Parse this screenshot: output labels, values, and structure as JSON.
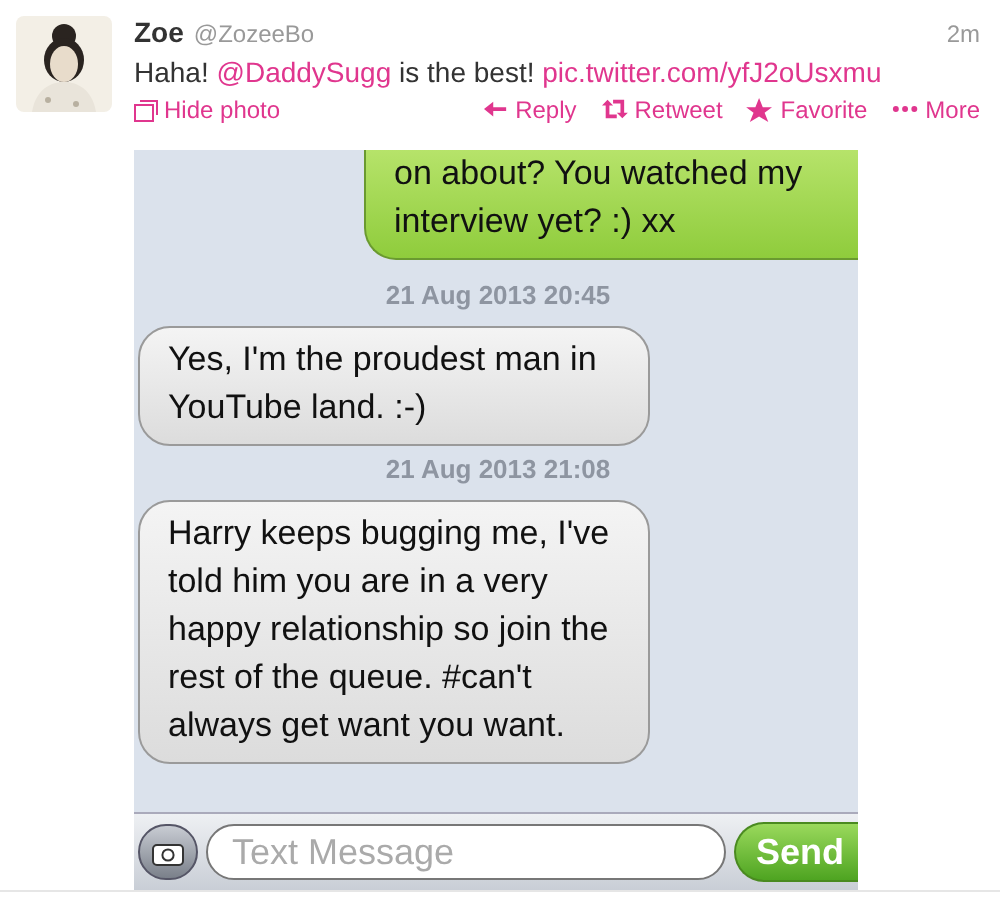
{
  "tweet": {
    "name": "Zoe",
    "handle": "@ZozeeBo",
    "time": "2m",
    "text": "Haha! ",
    "mention": "@DaddySugg",
    "text_after": " is the best! ",
    "link": "pic.twitter.com/yfJ2oUsxmu",
    "hide_photo": "Hide photo",
    "actions": [
      {
        "kind": "reply",
        "label": "Reply"
      },
      {
        "kind": "retweet",
        "label": "Retweet"
      },
      {
        "kind": "favorite",
        "label": "Favorite"
      },
      {
        "kind": "more",
        "label": "More"
      }
    ]
  },
  "photo": {
    "messages": [
      {
        "kind": "sent",
        "text": "on about? You watched my interview yet? :) xx"
      },
      {
        "kind": "timestamp",
        "text": "21 Aug 2013 20:45"
      },
      {
        "kind": "received",
        "text": "Yes, I'm the proudest man in YouTube land. :-)"
      },
      {
        "kind": "timestamp",
        "text": "21 Aug 2013 21:08"
      },
      {
        "kind": "received",
        "text": "Harry keeps bugging me, I've told him you are in a very happy relationship so join the rest of the queue. #can't always get want you want."
      }
    ],
    "input": {
      "placeholder": "Text Message",
      "send": "Send"
    }
  }
}
